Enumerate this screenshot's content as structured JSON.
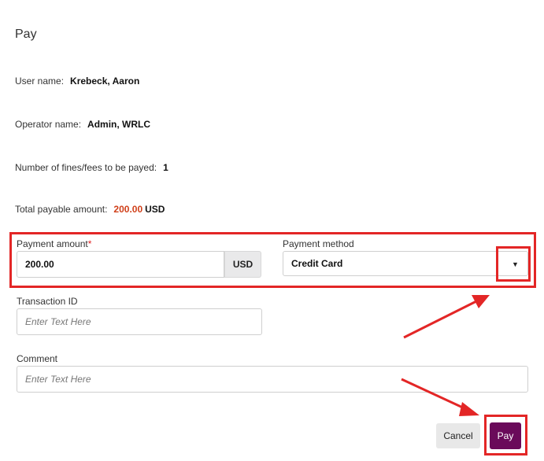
{
  "dialog": {
    "title": "Pay"
  },
  "info": {
    "user_name_label": "User name:",
    "user_name_value": "Krebeck, Aaron",
    "operator_label": "Operator name:",
    "operator_value": "Admin, WRLC",
    "fines_count_label": "Number of fines/fees to be payed:",
    "fines_count_value": "1",
    "total_label": "Total payable amount:",
    "total_amount": "200.00",
    "total_currency": "USD"
  },
  "form": {
    "payment_amount_label": "Payment amount",
    "required_marker": "*",
    "payment_amount_value": "200.00",
    "currency_addon": "USD",
    "payment_method_label": "Payment method",
    "payment_method_value": "Credit Card",
    "transaction_id_label": "Transaction ID",
    "transaction_id_placeholder": "Enter Text Here",
    "comment_label": "Comment",
    "comment_placeholder": "Enter Text Here"
  },
  "buttons": {
    "cancel_label": "Cancel",
    "pay_label": "Pay"
  },
  "colors": {
    "accent": "#6a0a5a",
    "highlight": "#e32626",
    "amount": "#d0401a"
  },
  "icons": {
    "dropdown": "chevron-down-icon"
  }
}
